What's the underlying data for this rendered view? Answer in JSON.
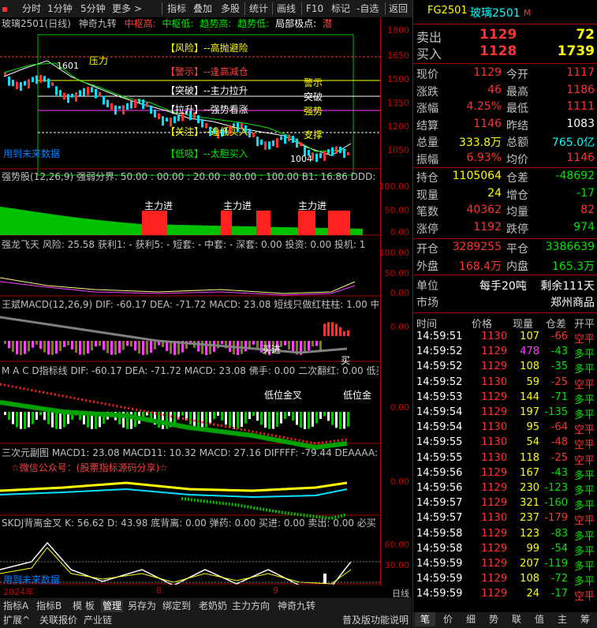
{
  "toolbar": {
    "items": [
      "分时",
      "1分钟",
      "5分钟",
      "更多 >",
      "指标",
      "叠加",
      "多股",
      "统计",
      "画线",
      "F10",
      "标记",
      "-自选",
      "返回"
    ]
  },
  "main_chart": {
    "title": "玻璃2501(日线)",
    "indicator": "神奇九转",
    "legend": [
      {
        "text": "中枢高:",
        "color": "#ff4040"
      },
      {
        "text": "中枢低:",
        "color": "#00e600"
      },
      {
        "text": "趋势高:",
        "color": "#00e600"
      },
      {
        "text": "趋势低:",
        "color": "#00e600"
      },
      {
        "text": "局部极点:",
        "color": "#ffffff"
      },
      {
        "text": "潜",
        "color": "#ff4040"
      }
    ],
    "zones": [
      "【风险】--高抛避险",
      "【警示】--逢高减仓",
      "【突破】--主力拉升",
      "【拉升】--强势看涨",
      "【关注】--逢低买入",
      "【低吸】--太胆买入"
    ],
    "right_labels": [
      "警示",
      "突破",
      "强势",
      "支撑"
    ],
    "labels": {
      "pressure": "压力",
      "high": "1601",
      "low": "1004",
      "future": "用到未来数据"
    },
    "y_ticks": [
      "1800",
      "1650",
      "1500",
      "1350",
      "1200",
      "1050"
    ]
  },
  "panels": [
    {
      "title": "强势股(12,26,9) 强弱分界: 50.00 : 00.00 : 20.00 : 80.00 : 100.00  B1: 16.86  DDD: 20",
      "y_ticks": [
        "100.00",
        "50.00",
        "0.00"
      ],
      "labels": [
        "主力进",
        "主力进",
        "主力进"
      ]
    },
    {
      "title": "强龙飞天 风险: 25.58 获利1: - 获利5: - 短套: - 中套: - 深套: 0.00 投资: 0.00 投机: 1",
      "y_ticks": [
        "100.00",
        "50.00",
        "0.00"
      ]
    },
    {
      "title": "王斌MACD(12,26,9) DIF: -60.17  DEA: -71.72  MACD: 23.08  短线只做红柱柱: 1.00  中",
      "y_ticks": [
        "0.00"
      ],
      "labels": [
        "买进",
        "买"
      ]
    },
    {
      "title": "M A C D指标线 DIF: -60.17  DEA: -71.72  MACD: 23.08  佛手: 0.00  二次翻红: 0.00  低买",
      "y_ticks": [
        "0.00"
      ],
      "labels": [
        "低位金叉",
        "低位金"
      ]
    },
    {
      "title": "三次元副图 MACD1: 23.08  MACD11: 10.32  MACD: 27.16  DIFFFF: -79.44  DEAAAA:",
      "y_ticks": [
        "0.00"
      ],
      "labels": [
        "☆微信公众号：(股票指标源码分享)☆"
      ]
    },
    {
      "title": "SKDJ背离金叉 K: 56.62  D: 43.98  底背离: 0.00  弹药: 0.00  买进: 0.00  卖出: 0.00  必买",
      "y_ticks": [
        "60.00",
        "30.00"
      ],
      "labels": [
        "用到未来数据"
      ]
    }
  ],
  "x_axis": {
    "labels": [
      "2024年",
      "8",
      "9"
    ],
    "period": "日线"
  },
  "bottom_tabs": [
    "指标A",
    "指标B",
    "模 板",
    "管理",
    "另存为",
    "绑定到",
    "老奶奶",
    "主力方向",
    "神奇九转"
  ],
  "bottom_tabs2": [
    "扩展^",
    "关联报价",
    "产业链"
  ],
  "bottom_status": "普及版功能说明",
  "quote": {
    "code": "FG2501",
    "name": "玻璃2501",
    "badge": "M",
    "sell": {
      "label": "卖出",
      "price": "1129",
      "vol": "72"
    },
    "buy": {
      "label": "买入",
      "price": "1128",
      "vol": "1739"
    },
    "rows1": [
      {
        "l1": "现价",
        "v1": "1129",
        "c1": "red",
        "l2": "今开",
        "v2": "1117",
        "c2": "red"
      },
      {
        "l1": "涨跌",
        "v1": "46",
        "c1": "red",
        "l2": "最高",
        "v2": "1186",
        "c2": "red"
      },
      {
        "l1": "涨幅",
        "v1": "4.25%",
        "c1": "red",
        "l2": "最低",
        "v2": "1111",
        "c2": "red"
      },
      {
        "l1": "结算",
        "v1": "1146",
        "c1": "red",
        "l2": "昨结",
        "v2": "1083",
        "c2": "white"
      },
      {
        "l1": "总量",
        "v1": "333.8万",
        "c1": "yellow",
        "l2": "总额",
        "v2": "765.0亿",
        "c2": "cyan"
      },
      {
        "l1": "振幅",
        "v1": "6.93%",
        "c1": "red",
        "l2": "均价",
        "v2": "1146",
        "c2": "red"
      }
    ],
    "rows2": [
      {
        "l1": "持仓",
        "v1": "1105064",
        "c1": "yellow",
        "l2": "仓差",
        "v2": "-48692",
        "c2": "green"
      },
      {
        "l1": "现量",
        "v1": "24",
        "c1": "yellow",
        "l2": "增仓",
        "v2": "-17",
        "c2": "green"
      },
      {
        "l1": "笔数",
        "v1": "40362",
        "c1": "red",
        "l2": "均量",
        "v2": "82",
        "c2": "red"
      },
      {
        "l1": "涨停",
        "v1": "1192",
        "c1": "red",
        "l2": "跌停",
        "v2": "974",
        "c2": "green"
      }
    ],
    "rows3": [
      {
        "l1": "开仓",
        "v1": "3289255",
        "c1": "red",
        "l2": "平仓",
        "v2": "3386639",
        "c2": "green"
      },
      {
        "l1": "外盘",
        "v1": "168.4万",
        "c1": "red",
        "l2": "内盘",
        "v2": "165.3万",
        "c2": "green"
      }
    ],
    "unit": {
      "l1": "单位",
      "v1": "每手20吨",
      "v2": "剩余111天"
    },
    "market": {
      "l1": "市场",
      "v1": "郑州商品"
    },
    "tick_header": [
      "时间",
      "价格",
      "现量",
      "仓差",
      "开平"
    ],
    "ticks": [
      {
        "t": "14:59:51",
        "p": "1130",
        "pc": "red",
        "v": "107",
        "vc": "yellow",
        "d": "-66",
        "dc": "red",
        "o": "空平",
        "oc": "red"
      },
      {
        "t": "14:59:52",
        "p": "1129",
        "pc": "red",
        "v": "478",
        "vc": "magenta",
        "d": "-43",
        "dc": "green",
        "o": "多平",
        "oc": "green"
      },
      {
        "t": "14:59:52",
        "p": "1129",
        "pc": "red",
        "v": "108",
        "vc": "yellow",
        "d": "-35",
        "dc": "green",
        "o": "多平",
        "oc": "green"
      },
      {
        "t": "14:59:52",
        "p": "1130",
        "pc": "red",
        "v": "59",
        "vc": "yellow",
        "d": "-25",
        "dc": "red",
        "o": "空平",
        "oc": "red"
      },
      {
        "t": "14:59:53",
        "p": "1129",
        "pc": "red",
        "v": "144",
        "vc": "yellow",
        "d": "-71",
        "dc": "green",
        "o": "多平",
        "oc": "green"
      },
      {
        "t": "14:59:54",
        "p": "1129",
        "pc": "red",
        "v": "197",
        "vc": "yellow",
        "d": "-135",
        "dc": "green",
        "o": "多平",
        "oc": "green"
      },
      {
        "t": "14:59:54",
        "p": "1130",
        "pc": "red",
        "v": "95",
        "vc": "yellow",
        "d": "-64",
        "dc": "red",
        "o": "空平",
        "oc": "red"
      },
      {
        "t": "14:59:55",
        "p": "1130",
        "pc": "red",
        "v": "54",
        "vc": "yellow",
        "d": "-48",
        "dc": "red",
        "o": "空平",
        "oc": "red"
      },
      {
        "t": "14:59:55",
        "p": "1130",
        "pc": "red",
        "v": "118",
        "vc": "yellow",
        "d": "-25",
        "dc": "red",
        "o": "空平",
        "oc": "red"
      },
      {
        "t": "14:59:56",
        "p": "1129",
        "pc": "red",
        "v": "167",
        "vc": "yellow",
        "d": "-43",
        "dc": "green",
        "o": "多平",
        "oc": "green"
      },
      {
        "t": "14:59:56",
        "p": "1129",
        "pc": "red",
        "v": "230",
        "vc": "yellow",
        "d": "-123",
        "dc": "green",
        "o": "多平",
        "oc": "green"
      },
      {
        "t": "14:59:57",
        "p": "1129",
        "pc": "red",
        "v": "321",
        "vc": "yellow",
        "d": "-160",
        "dc": "green",
        "o": "多平",
        "oc": "green"
      },
      {
        "t": "14:59:57",
        "p": "1130",
        "pc": "red",
        "v": "237",
        "vc": "yellow",
        "d": "-179",
        "dc": "red",
        "o": "空平",
        "oc": "red"
      },
      {
        "t": "14:59:58",
        "p": "1129",
        "pc": "red",
        "v": "123",
        "vc": "yellow",
        "d": "-83",
        "dc": "green",
        "o": "多平",
        "oc": "green"
      },
      {
        "t": "14:59:58",
        "p": "1129",
        "pc": "red",
        "v": "99",
        "vc": "yellow",
        "d": "-54",
        "dc": "green",
        "o": "多平",
        "oc": "green"
      },
      {
        "t": "14:59:59",
        "p": "1129",
        "pc": "red",
        "v": "207",
        "vc": "yellow",
        "d": "-119",
        "dc": "green",
        "o": "多平",
        "oc": "green"
      },
      {
        "t": "14:59:59",
        "p": "1129",
        "pc": "red",
        "v": "108",
        "vc": "yellow",
        "d": "-72",
        "dc": "green",
        "o": "多平",
        "oc": "green"
      },
      {
        "t": "14:59:59",
        "p": "1129",
        "pc": "red",
        "v": "24",
        "vc": "yellow",
        "d": "-17",
        "dc": "green",
        "o": "空平",
        "oc": "red"
      }
    ],
    "tabs": [
      "笔",
      "价",
      "细",
      "势",
      "联",
      "值",
      "主",
      "筹"
    ]
  }
}
